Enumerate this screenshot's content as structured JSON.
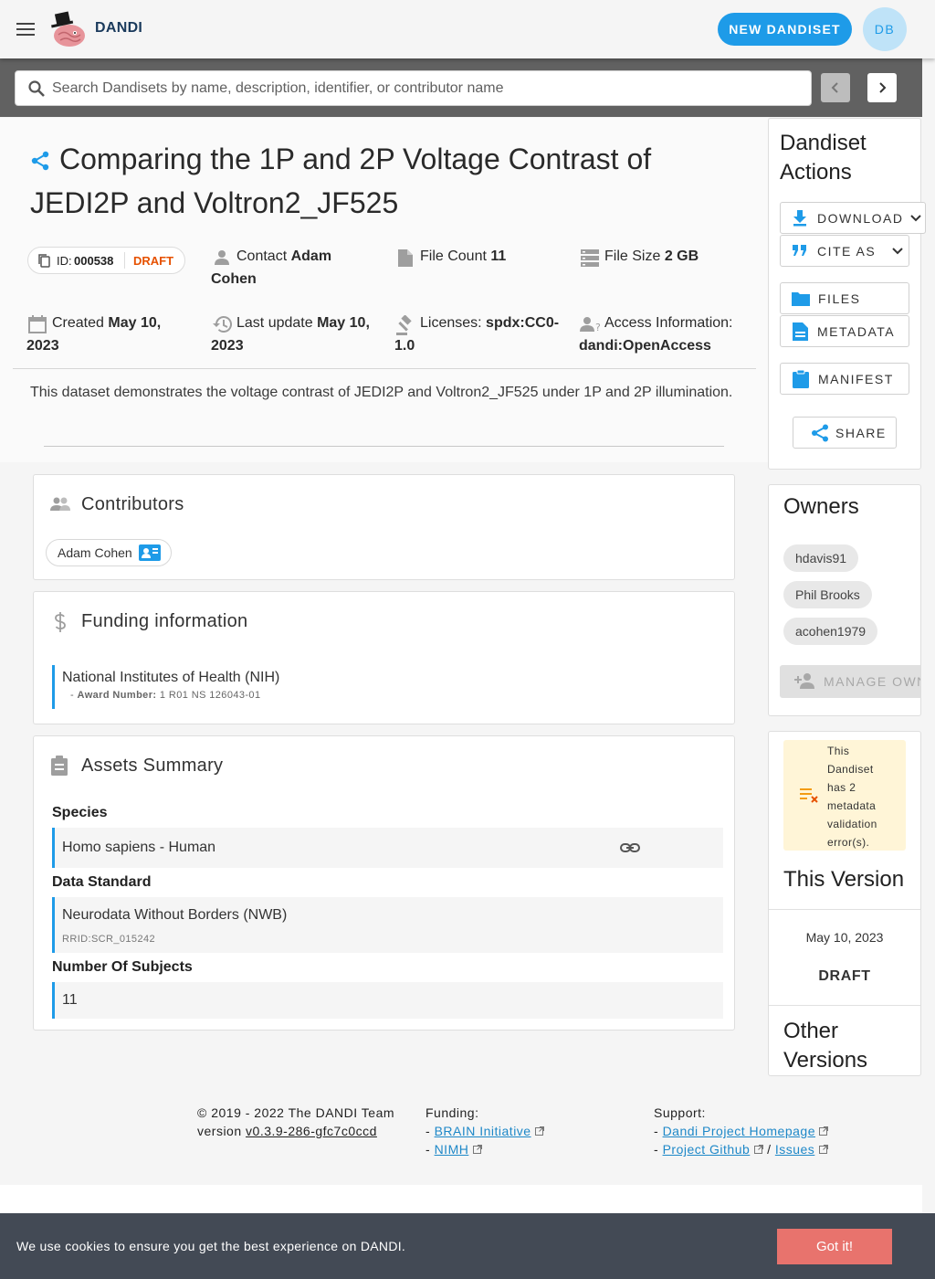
{
  "appbar": {
    "brand": "DANDI",
    "new_dandiset": "NEW DANDISET",
    "avatar": "DB"
  },
  "search": {
    "placeholder": "Search Dandisets by name, description, identifier, or contributor name"
  },
  "dandiset": {
    "title": "Comparing the 1P and 2P Voltage Contrast of JEDI2P and Voltron2_JF525",
    "id_label": "ID:",
    "id": "000538",
    "status": "DRAFT",
    "contact_label": "Contact",
    "contact_first": "Adam",
    "contact_last": "Cohen",
    "file_count_label": "File Count",
    "file_count": "11",
    "file_size_label": "File Size",
    "file_size": "2 GB",
    "created_label": "Created",
    "created_1": "May 10,",
    "created_2": "2023",
    "updated_label": "Last update",
    "updated_1": "May 10,",
    "updated_2": "2023",
    "licenses_label": "Licenses:",
    "license_1": "spdx:CC0-",
    "license_2": "1.0",
    "access_label": "Access Information:",
    "access": "dandi:OpenAccess",
    "description": "This dataset demonstrates the voltage contrast of JEDI2P and Voltron2_JF525 under 1P and 2P illumination."
  },
  "contributors": {
    "title": "Contributors",
    "items": [
      "Adam Cohen"
    ]
  },
  "funding": {
    "title": "Funding information",
    "org": "National Institutes of Health (NIH)",
    "award_prefix": "-",
    "award_label": "Award Number:",
    "award": "1 R01 NS 126043-01"
  },
  "assets": {
    "title": "Assets Summary",
    "species_label": "Species",
    "species": "Homo sapiens - Human",
    "standard_label": "Data Standard",
    "standard": "Neurodata Without Borders (NWB)",
    "standard_rrid": "RRID:SCR_015242",
    "subjects_label": "Number Of Subjects",
    "subjects": "11"
  },
  "actions": {
    "title_1": "Dandiset",
    "title_2": "Actions",
    "download": "DOWNLOAD",
    "cite": "CITE AS",
    "files": "FILES",
    "metadata": "METADATA",
    "manifest": "MANIFEST",
    "share": "SHARE"
  },
  "owners": {
    "title": "Owners",
    "items": [
      "hdavis91",
      "Phil Brooks",
      "acohen1979"
    ],
    "manage": "MANAGE OWN"
  },
  "validation": {
    "lines": [
      "This",
      "Dandiset",
      "has 2",
      "metadata",
      "validation",
      "error(s)."
    ]
  },
  "version": {
    "title": "This Version",
    "date": "May 10, 2023",
    "status": "DRAFT",
    "other_1": "Other",
    "other_2": "Versions"
  },
  "footer": {
    "copyright": "© 2019 - 2022 The DANDI Team",
    "version_label": "version",
    "version": "v0.3.9-286-gfc7c0ccd",
    "funding_label": "Funding:",
    "funding_links": [
      "BRAIN Initiative",
      "NIMH"
    ],
    "support_label": "Support:",
    "support_home": "Dandi Project Homepage",
    "support_github": "Project Github",
    "support_sep": "/",
    "support_issues": "Issues",
    "dash": "-"
  },
  "cookie": {
    "message": "We use cookies to ensure you get the best experience on DANDI.",
    "button": "Got it!"
  },
  "colors": {
    "accent": "#1e9be8",
    "draft": "#e65100",
    "warning_bg": "#fff5d7",
    "cookie_bg": "#434a55",
    "cookie_btn": "#e8736d"
  },
  "icons": [
    "menu-icon",
    "dandi-logo",
    "search-icon",
    "chevron-left-icon",
    "chevron-right-icon",
    "share-icon",
    "copy-icon",
    "person-icon",
    "file-icon",
    "storage-icon",
    "calendar-icon",
    "history-icon",
    "gavel-icon",
    "person-question-icon",
    "contact-card-icon",
    "people-icon",
    "dollar-icon",
    "clipboard-icon",
    "link-icon",
    "download-icon",
    "quote-icon",
    "folder-icon",
    "document-icon",
    "manifest-icon",
    "person-add-icon",
    "warning-list-icon",
    "external-link-icon"
  ]
}
